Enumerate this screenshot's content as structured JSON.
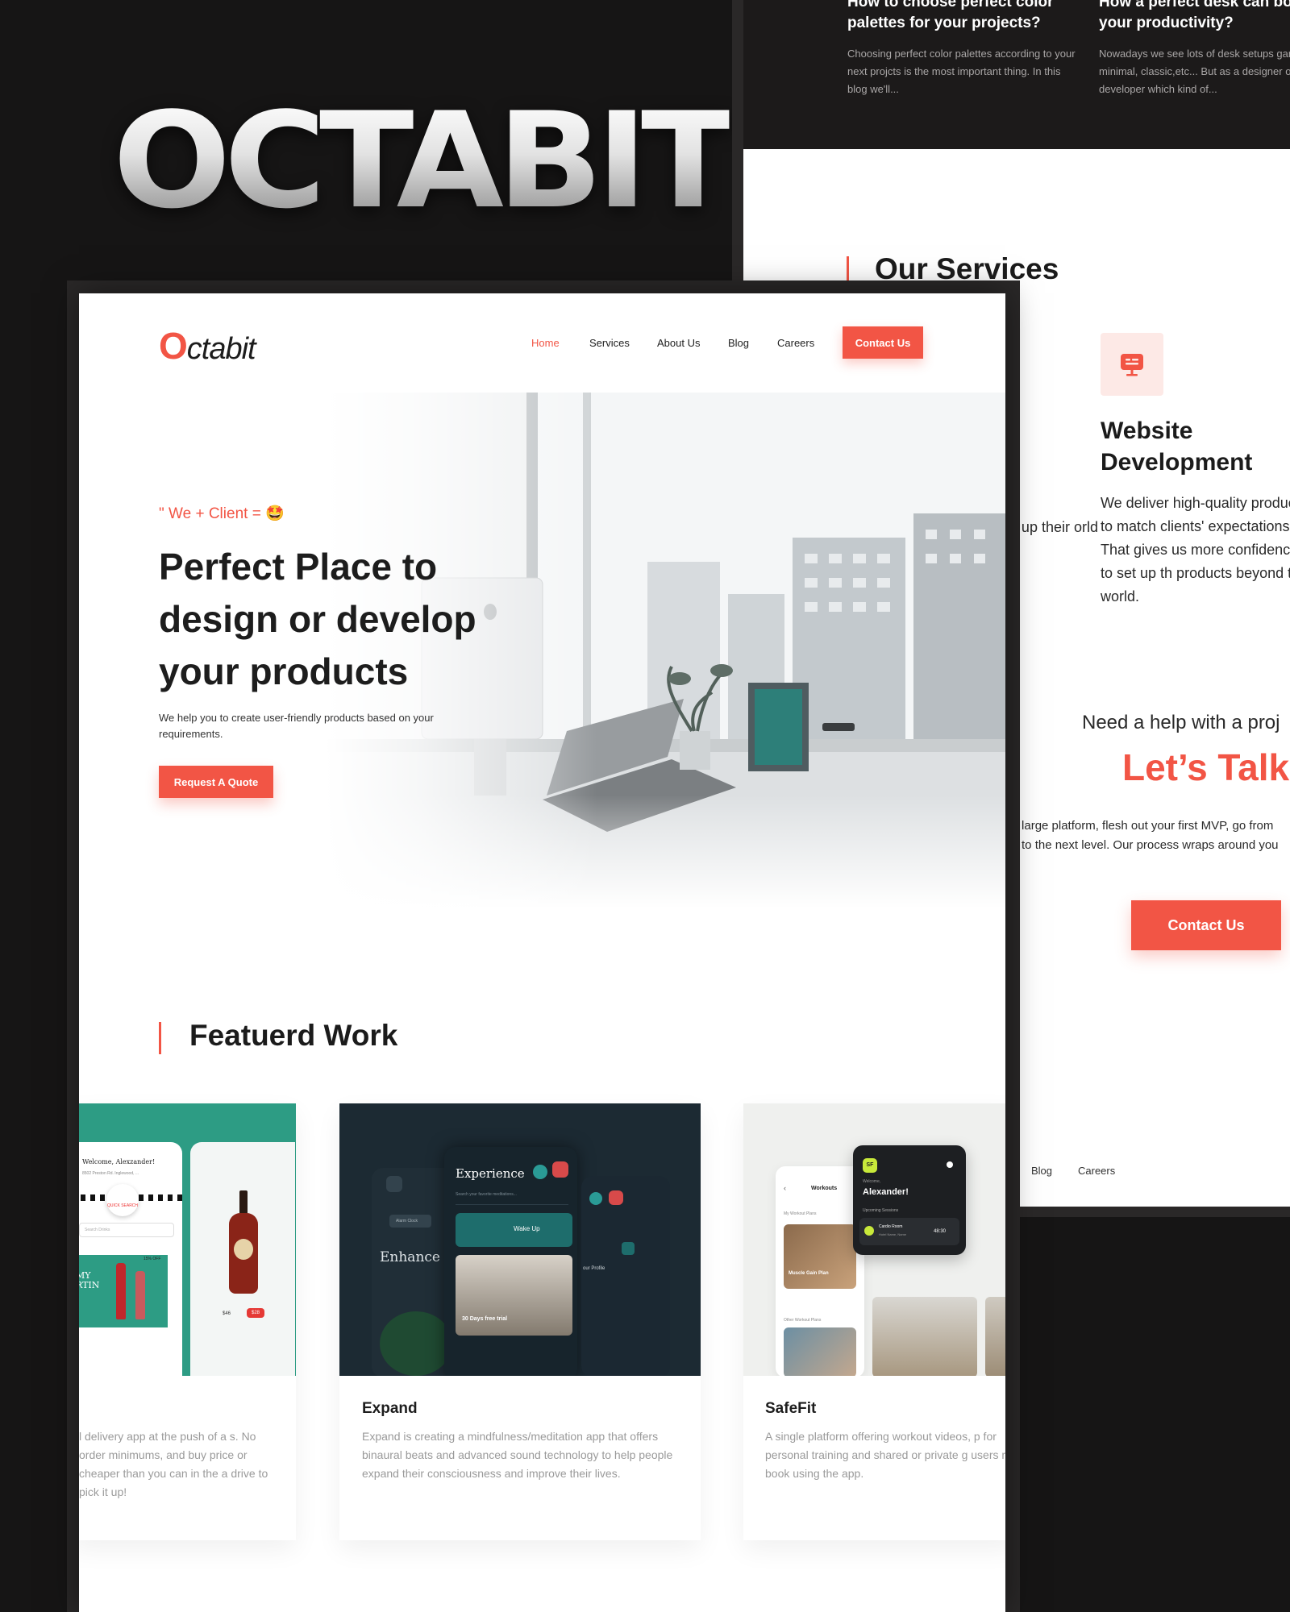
{
  "brand_title": "OCTABIT",
  "colors": {
    "accent": "#f25545",
    "background": "#161515",
    "teal": "#2d9c84",
    "navy": "#1c2a33"
  },
  "back": {
    "blog": [
      {
        "title": "How to choose perfect color palettes for your projects?",
        "text": "Choosing perfect color palettes according to your next projcts is the most important thing. In this blog we'll..."
      },
      {
        "title": "How a perfect desk can boo your productivity?",
        "text": "Nowadays we see lots of desk setups gaming, minimal, classic,etc... But as a designer or developer which kind of..."
      }
    ],
    "services": {
      "heading": "Our Services",
      "partial_text": "ts' us up their orld.",
      "icon": "monitor-icon",
      "title": "Website Development",
      "desc": "We deliver high-quality products to match clients' expectations. That gives us more confidence to set up th products beyond the world."
    },
    "help": {
      "question": "Need a help with a proj",
      "cta_title": "Let’s Talk!",
      "line1": "n a large platform, flesh out your first MVP, go from",
      "line2": "tup to the next level. Our process wraps around you",
      "button": "Contact Us"
    },
    "footer_nav": {
      "blog": "Blog",
      "careers": "Careers"
    }
  },
  "front": {
    "logo_o": "O",
    "logo_rest": "ctabit",
    "nav": {
      "home": "Home",
      "services": "Services",
      "about": "About Us",
      "blog": "Blog",
      "careers": "Careers",
      "contact": "Contact Us"
    },
    "hero": {
      "tagline": "\" We + Client = 🤩",
      "title": "Perfect Place to design or develop your products",
      "subtitle": "We help you to create user-friendly products based on your requirements.",
      "button": "Request A Quote"
    },
    "featured": {
      "heading": "Featuerd Work",
      "items": [
        {
          "name": "",
          "desc": "l delivery app at the push of a s. No order minimums, and buy price or cheaper than you can in the a drive to pick it up!",
          "mock": {
            "welcome": "Welcome, Alexzander!",
            "address": "8502 Preston Rd. Inglewood, ...",
            "quick": "QUICK SEARCH",
            "search": "Search Drinks",
            "wine_label": "MY RTIN",
            "discount": "15% OFF",
            "price": "$46",
            "badge": "$28"
          }
        },
        {
          "name": "Expand",
          "desc": "Expand is creating a mindfulness/meditation app that offers binaural beats and advanced sound technology to help people expand their consciousness and improve their lives.",
          "mock": {
            "experience": "Experience",
            "search": "Search your favorite meditations...",
            "enhance": "Enhance Positive Er",
            "wake": "Wake Up",
            "trial": "30 Days free trial",
            "profile": "our Profile",
            "alarm": "Alarm Clock"
          }
        },
        {
          "name": "SafeFit",
          "desc": "A single platform offering workout videos, p for personal training and shared or private g users may book using the app.",
          "mock": {
            "badge": "SF",
            "workouts": "Workouts",
            "hello": "Welcome,",
            "name": "Alexander!",
            "upcoming": "Upcoming Sessions",
            "session": "Cardio Room",
            "session_sub": "Hotel Name, Name",
            "time": "48:30",
            "plans": "My Workout Plans",
            "muscle": "Muscle Gain Plan",
            "other": "Other Workout Plans"
          }
        }
      ]
    }
  }
}
